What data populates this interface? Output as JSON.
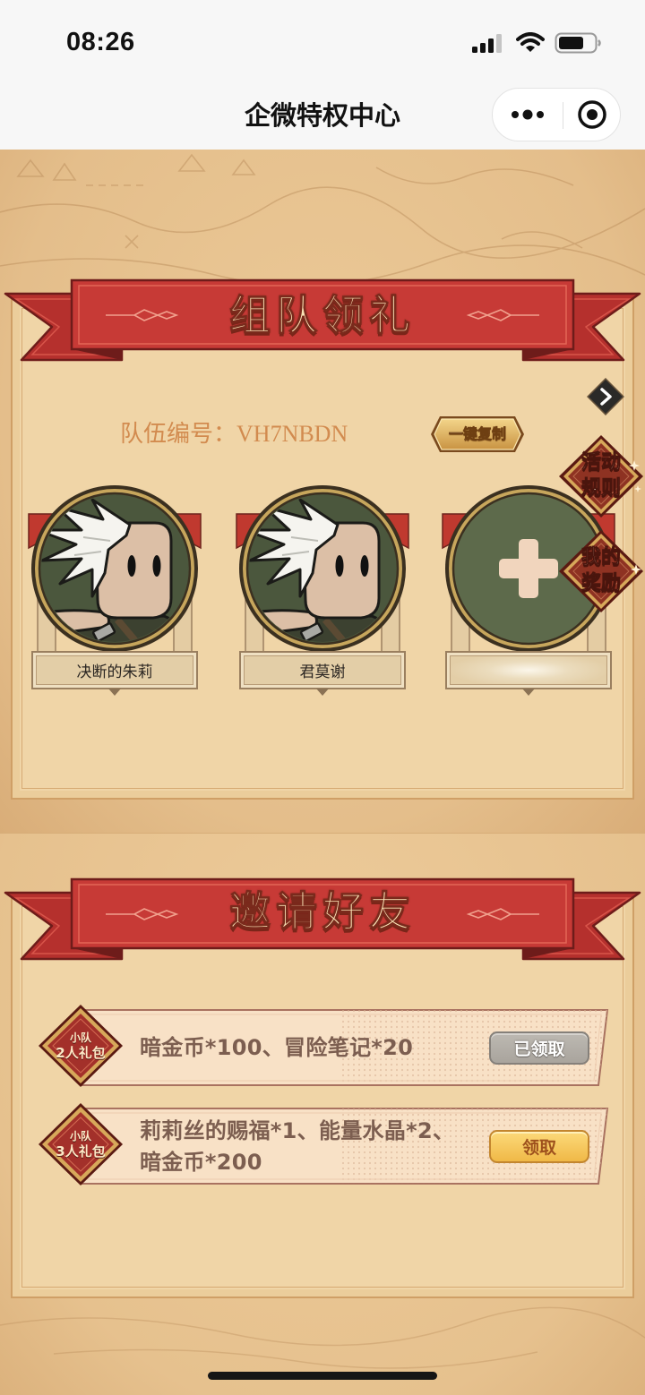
{
  "status_bar": {
    "time": "08:26",
    "icons": [
      "cellular-signal-icon",
      "wifi-icon",
      "battery-icon"
    ]
  },
  "nav": {
    "title": "企微特权中心",
    "more_icon": "more-dots-icon",
    "exit_icon": "exit-target-icon"
  },
  "team": {
    "title": "组队领礼",
    "id_label": "队伍编号：",
    "id_value": "VH7NBDN",
    "copy_button": "一键复制",
    "expand_icon": "chevron-right-icon",
    "members": [
      {
        "name": "决断的朱莉",
        "filled": true,
        "avatar_icon": "white-haired-character-avatar"
      },
      {
        "name": "君莫谢",
        "filled": true,
        "avatar_icon": "white-haired-character-avatar"
      },
      {
        "filled": false,
        "avatar_icon": "plus-icon"
      }
    ]
  },
  "side_buttons": {
    "rules": {
      "line1": "活动",
      "line2": "规则"
    },
    "my_rewards": {
      "line1": "我的",
      "line2": "奖励"
    }
  },
  "invite": {
    "title": "邀请好友",
    "tiers": [
      {
        "badge_top": "小队",
        "badge_bottom": "2人礼包",
        "reward_lines": [
          "暗金币*100、冒险笔记*20"
        ],
        "button": "已领取",
        "claimed": true
      },
      {
        "badge_top": "小队",
        "badge_bottom": "3人礼包",
        "reward_lines": [
          "莉莉丝的赐福*1、能量水晶*2、",
          "暗金币*200"
        ],
        "button": "领取",
        "claimed": false
      }
    ]
  },
  "colors": {
    "parchment": "#e8c594",
    "panel": "#f0d5a7",
    "ribbon_red": "#c73a36",
    "team_id_text": "#d28b4f",
    "reward_text": "#7c5e50",
    "claimed_button": "#b3aea7",
    "claim_button": "#f4c45a"
  }
}
